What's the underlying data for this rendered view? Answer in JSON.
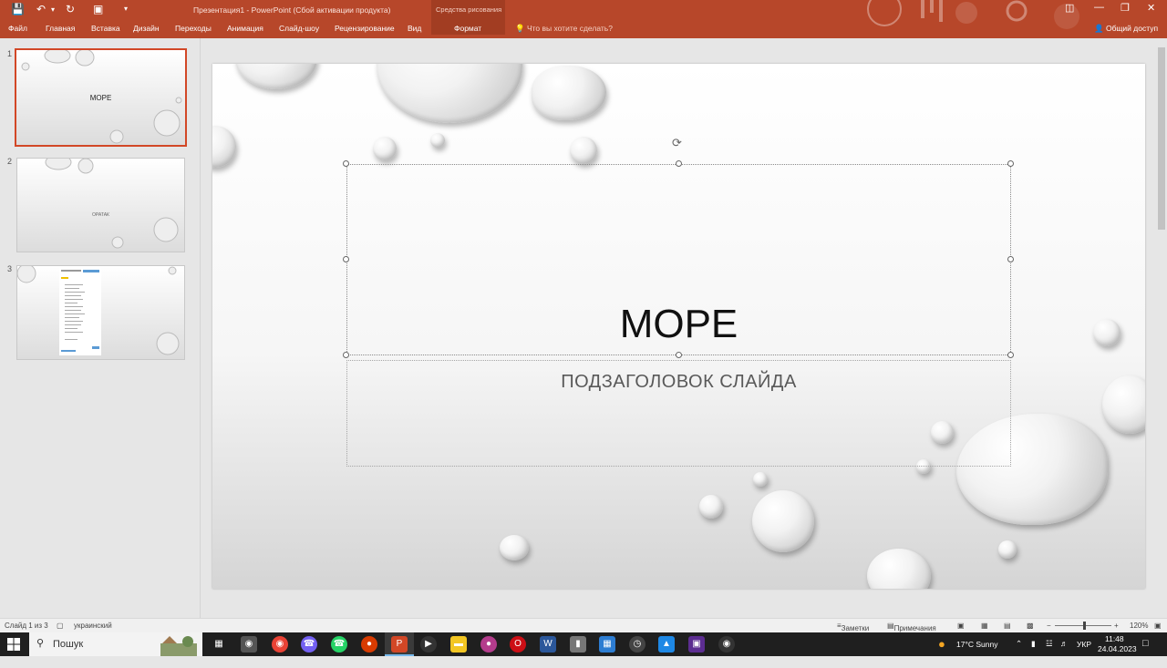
{
  "app": {
    "title": "Презентация1 - PowerPoint (Сбой активации продукта)",
    "context_group": "Средства рисования",
    "tell_me": "Что вы хотите сделать?",
    "share": "Общий доступ",
    "tabs": [
      "Файл",
      "Главная",
      "Вставка",
      "Дизайн",
      "Переходы",
      "Анимация",
      "Слайд-шоу",
      "Рецензирование",
      "Вид",
      "Формат"
    ]
  },
  "thumbnails": [
    {
      "num": "1",
      "title": "МОРЕ"
    },
    {
      "num": "2",
      "title": "ОРАТАК"
    },
    {
      "num": "3",
      "title": ""
    }
  ],
  "slide": {
    "title": "МОРЕ",
    "subtitle": "ПОДЗАГОЛОВОК СЛАЙДА"
  },
  "status": {
    "slide_counter": "Слайд 1 из 3",
    "language": "украинский",
    "notes": "Заметки",
    "comments": "Примечания",
    "zoom": "120%"
  },
  "taskbar": {
    "search": "Пошук",
    "weather": "17°C  Sunny",
    "lang": "УКР",
    "time": "11:48",
    "date": "24.04.2023"
  },
  "colors": {
    "accent": "#b7472a",
    "active_thumb_border": "#d24726"
  }
}
